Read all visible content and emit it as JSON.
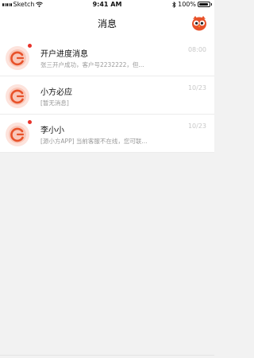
{
  "status_bar": {
    "carrier": "Sketch",
    "time": "9:41 AM",
    "battery": "100%"
  },
  "header": {
    "title": "消息"
  },
  "conversations": [
    {
      "name": "开户进度消息",
      "preview": "张三开户成功，客户号2232222，但...",
      "time": "08:00",
      "unread": true
    },
    {
      "name": "小方必应",
      "preview": "[暂无消息]",
      "time": "10/23",
      "unread": false
    },
    {
      "name": "李小小",
      "preview": "[源小方APP] 当前客服不在线，您可联...",
      "time": "10/23",
      "unread": true
    }
  ],
  "colors": {
    "accent": "#e8522a",
    "unread_dot": "#e8322a",
    "avatar_bg": "#fde3dc"
  },
  "icons": {
    "header_avatar": "owl-mascot-icon",
    "conversation_avatar": "app-logo-icon"
  }
}
